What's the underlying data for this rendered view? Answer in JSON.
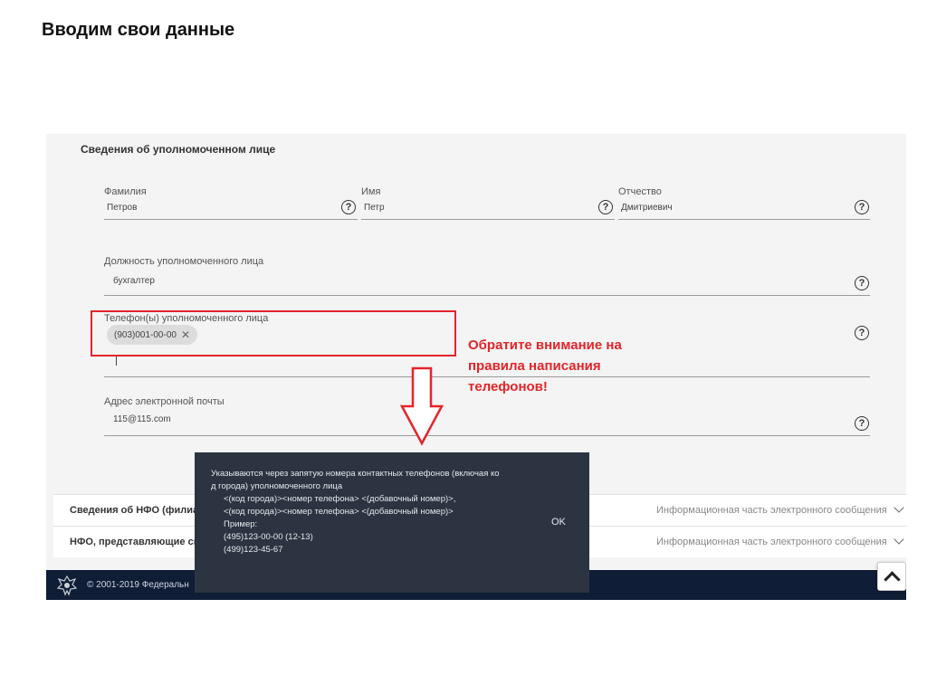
{
  "slide": {
    "title": "Вводим свои данные"
  },
  "form": {
    "section_title": "Сведения об уполномоченном лице",
    "last_name": {
      "label": "Фамилия",
      "value": "Петров"
    },
    "first_name": {
      "label": "Имя",
      "value": "Петр"
    },
    "patronymic": {
      "label": "Отчество",
      "value": "Дмитриевич"
    },
    "position": {
      "label": "Должность уполномоченного лица",
      "value": "бухгалтер"
    },
    "phones": {
      "label": "Телефон(ы) уполномоченного лица",
      "chip": "(903)001-00-00"
    },
    "email": {
      "label": "Адрес электронной почты",
      "value": "115@115.com"
    },
    "help_glyph": "?"
  },
  "accordions": [
    {
      "title": "Сведения об НФО (филиал",
      "subtitle": "Информационная часть электронного сообщения"
    },
    {
      "title": "НФО, представляющие све",
      "subtitle": "Информационная часть электронного сообщения"
    }
  ],
  "footer": {
    "text": "© 2001-2019 Федеральн"
  },
  "tooltip": {
    "line1": "Указываются через запятую номера контактных телефонов (включая ко",
    "line2": "д города) уполномоченного лица",
    "line3": "<(код города)><номер телефона> <(добавочный номер)>,",
    "line4": "<(код города)><номер телефона> <(добавочный номер)>",
    "line5": "Пример:",
    "line6": "(495)123-00-00 (12-13)",
    "line7": "(499)123-45-67",
    "ok": "OK"
  },
  "annotation": {
    "callout_line1": "Обратите внимание на",
    "callout_line2": "правила написания",
    "callout_line3": "телефонов!",
    "color": "#e4242a"
  },
  "icons": [
    "help-icon",
    "chip-close-icon",
    "chevron-down-icon",
    "scroll-top-icon",
    "emblem-icon",
    "down-arrow-icon"
  ]
}
